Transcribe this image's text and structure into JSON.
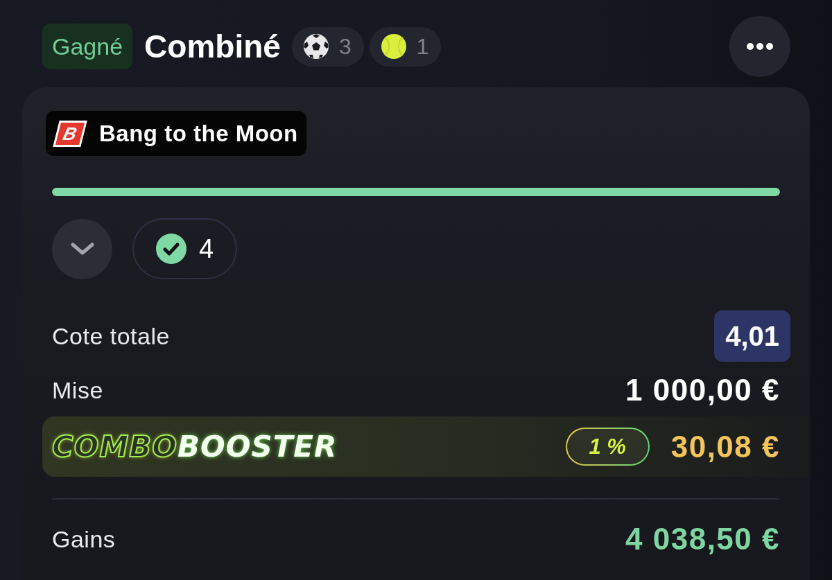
{
  "header": {
    "status": {
      "label": "Gagné",
      "kind": "won"
    },
    "title": "Combiné",
    "sports": [
      {
        "kind": "football",
        "count": "3"
      },
      {
        "kind": "tennis",
        "count": "1"
      }
    ]
  },
  "card": {
    "promo_tag": {
      "logo_letter": "B",
      "label": "Bang to the Moon"
    },
    "progress": {
      "level": 1
    },
    "legs": {
      "expanded": false,
      "won_count": "4"
    },
    "summary": [
      {
        "kind": "odds",
        "label": "Cote totale",
        "value": "4,01"
      },
      {
        "kind": "stake",
        "label": "Mise",
        "value": "1 000,00 €"
      }
    ],
    "booster": {
      "logo": [
        "COMBO",
        "BOOSTER"
      ],
      "percent": "1 %",
      "amount": "30,08 €"
    },
    "payout": {
      "label": "Gains",
      "value": "4 038,50 €"
    }
  }
}
